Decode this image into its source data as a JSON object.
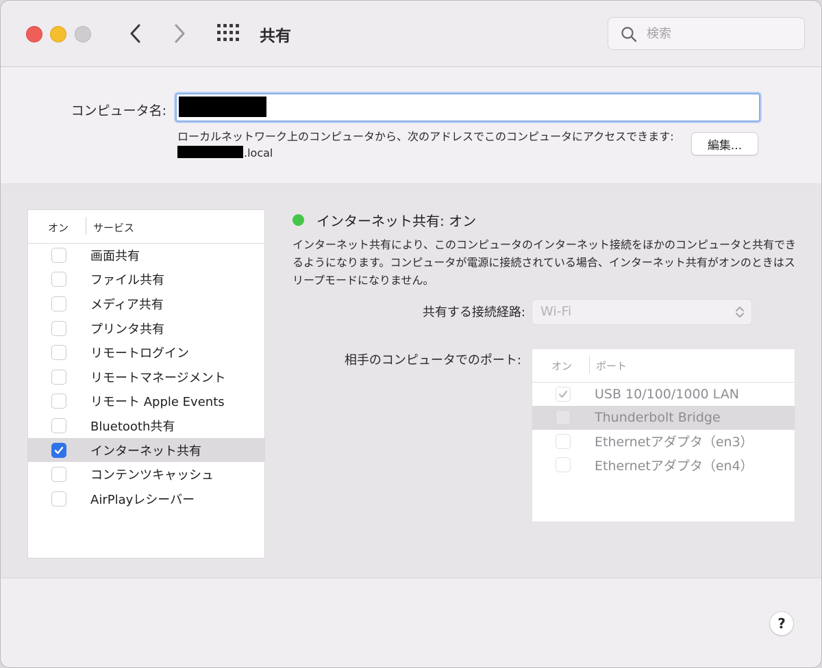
{
  "window": {
    "title": "共有"
  },
  "search": {
    "placeholder": "検索"
  },
  "computer_name": {
    "label": "コンピュータ名:",
    "address_text": "ローカルネットワーク上のコンピュータから、次のアドレスでこのコンピュータにアクセスできます:",
    "address_suffix": ".local",
    "edit_label": "編集..."
  },
  "services": {
    "header_on": "オン",
    "header_service": "サービス",
    "items": [
      {
        "label": "画面共有",
        "checked": false
      },
      {
        "label": "ファイル共有",
        "checked": false
      },
      {
        "label": "メディア共有",
        "checked": false
      },
      {
        "label": "プリンタ共有",
        "checked": false
      },
      {
        "label": "リモートログイン",
        "checked": false
      },
      {
        "label": "リモートマネージメント",
        "checked": false
      },
      {
        "label": "リモート Apple Events",
        "checked": false
      },
      {
        "label": "Bluetooth共有",
        "checked": false
      },
      {
        "label": "インターネット共有",
        "checked": true,
        "selected": true
      },
      {
        "label": "コンテンツキャッシュ",
        "checked": false
      },
      {
        "label": "AirPlayレシーバー",
        "checked": false
      }
    ]
  },
  "detail": {
    "status_title": "インターネット共有: オン",
    "status_color": "#45c64a",
    "description": "インターネット共有により、このコンピュータのインターネット接続をほかのコンピュータと共有できるようになります。コンピュータが電源に接続されている場合、インターネット共有がオンのときはスリープモードになりません。",
    "route_label": "共有する接続経路:",
    "route_value": "Wi-Fi",
    "ports_label": "相手のコンピュータでのポート:",
    "ports_header_on": "オン",
    "ports_header_port": "ポート",
    "ports": [
      {
        "label": "USB 10/100/1000 LAN",
        "checked": true
      },
      {
        "label": "Thunderbolt Bridge",
        "checked": false,
        "selected": true
      },
      {
        "label": "Ethernetアダプタ（en3）",
        "checked": false
      },
      {
        "label": "Ethernetアダプタ（en4）",
        "checked": false
      }
    ]
  },
  "help": {
    "label": "?"
  }
}
